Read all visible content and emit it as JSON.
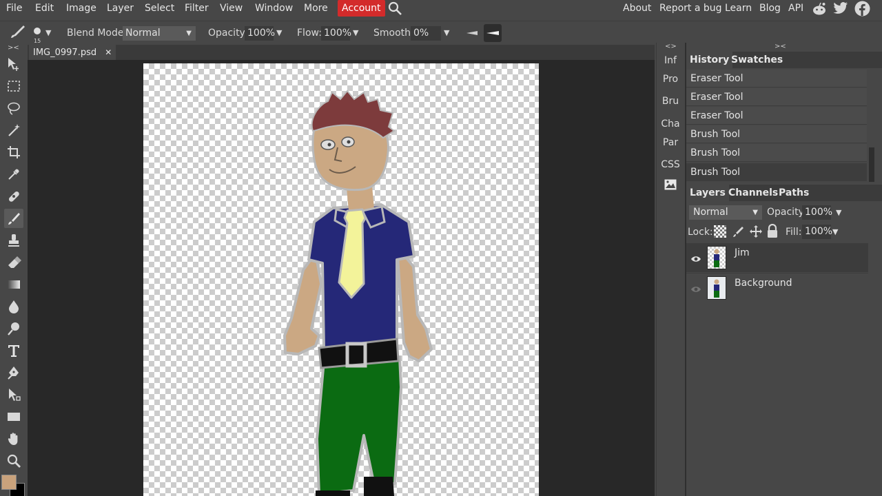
{
  "menu": {
    "file": "File",
    "edit": "Edit",
    "image": "Image",
    "layer": "Layer",
    "select": "Select",
    "filter": "Filter",
    "view": "View",
    "window": "Window",
    "more": "More",
    "account": "Account",
    "about": "About",
    "report": "Report a bug",
    "learn": "Learn",
    "blog": "Blog",
    "api": "API"
  },
  "options": {
    "brush_size": "15",
    "blend_label": "Blend Mode:",
    "blend_value": "Normal",
    "opacity_label": "Opacity:",
    "opacity_value": "100%",
    "flow_label": "Flow:",
    "flow_value": "100%",
    "smooth_label": "Smooth:",
    "smooth_value": "0%"
  },
  "doc": {
    "collapse": "><",
    "tab_name": "IMG_0997.psd",
    "close": "✕"
  },
  "mini_panels": {
    "expand": "<>",
    "items": [
      "Inf",
      "Pro",
      "Bru",
      "Cha",
      "Par",
      "CSS"
    ]
  },
  "history_panel": {
    "collapse": "><",
    "tabs": [
      "History",
      "Swatches"
    ],
    "items": [
      "Eraser Tool",
      "Eraser Tool",
      "Eraser Tool",
      "Brush Tool",
      "Brush Tool",
      "Brush Tool"
    ]
  },
  "layers_panel": {
    "tabs": [
      "Layers",
      "Channels",
      "Paths"
    ],
    "blend": "Normal",
    "opacity_label": "Opacity:",
    "opacity_value": "100%",
    "lock_label": "Lock:",
    "fill_label": "Fill:",
    "fill_value": "100%",
    "layers": [
      {
        "name": "Jim",
        "visible": true,
        "selected": true
      },
      {
        "name": "Background",
        "visible": false,
        "selected": false
      }
    ]
  },
  "colors": {
    "foreground": "#c9a27c",
    "background": "#000000",
    "accent": "#d32b2b"
  },
  "icons": [
    "search-icon",
    "reddit-icon",
    "twitter-icon",
    "facebook-icon"
  ]
}
